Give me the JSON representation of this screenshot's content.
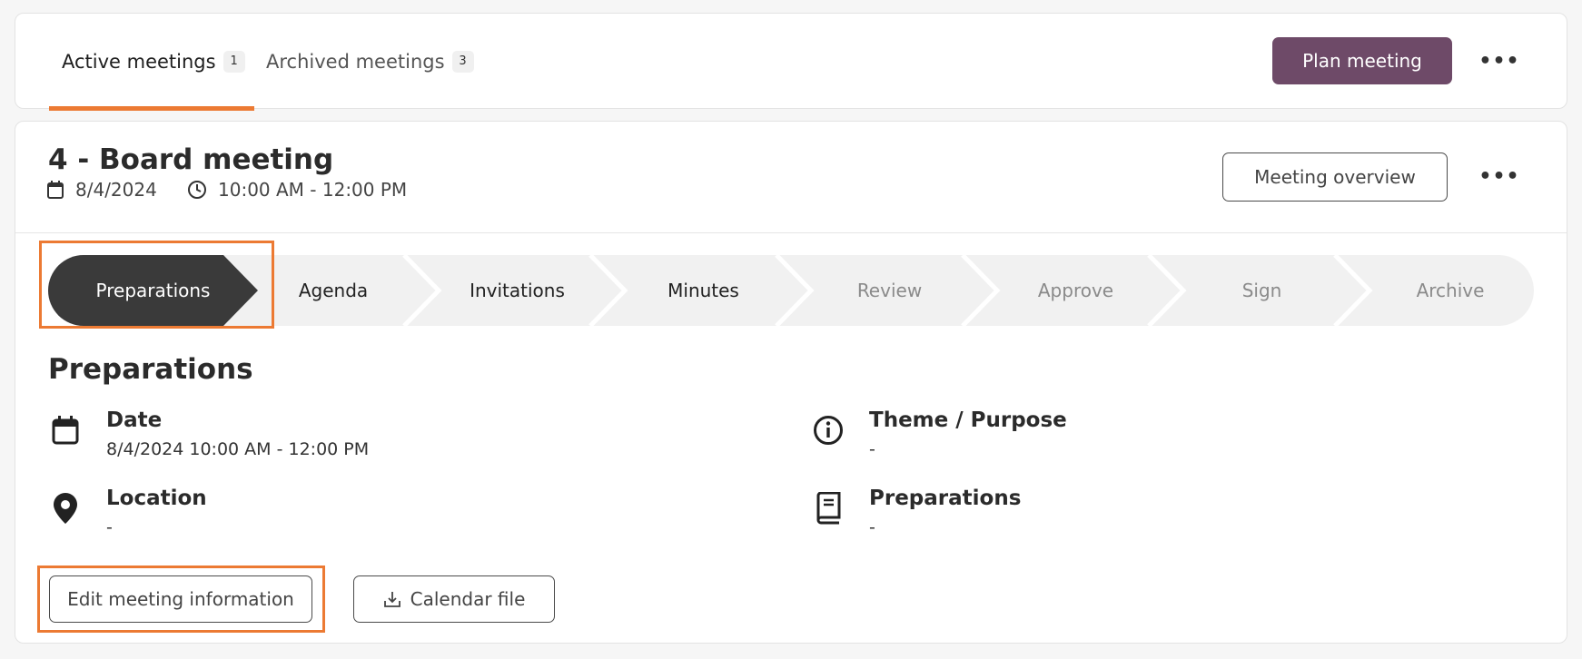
{
  "tabs": [
    {
      "label": "Active meetings",
      "count": "1"
    },
    {
      "label": "Archived meetings",
      "count": "3"
    }
  ],
  "header": {
    "plan_button": "Plan meeting",
    "more_label": "•••"
  },
  "meeting": {
    "title": "4 - Board meeting",
    "date": "8/4/2024",
    "time": "10:00 AM - 12:00 PM",
    "overview_button": "Meeting overview",
    "more_label": "•••"
  },
  "stepper": {
    "steps": [
      {
        "label": "Preparations",
        "state": "active"
      },
      {
        "label": "Agenda",
        "state": "done"
      },
      {
        "label": "Invitations",
        "state": "done"
      },
      {
        "label": "Minutes",
        "state": "done"
      },
      {
        "label": "Review",
        "state": "todo"
      },
      {
        "label": "Approve",
        "state": "todo"
      },
      {
        "label": "Sign",
        "state": "todo"
      },
      {
        "label": "Archive",
        "state": "todo"
      }
    ]
  },
  "section": {
    "title": "Preparations",
    "details": {
      "date": {
        "label": "Date",
        "value": "8/4/2024 10:00 AM - 12:00 PM",
        "icon": "calendar-icon"
      },
      "location": {
        "label": "Location",
        "value": "-",
        "icon": "location-pin-icon"
      },
      "theme": {
        "label": "Theme / Purpose",
        "value": "-",
        "icon": "info-icon"
      },
      "preparations": {
        "label": "Preparations",
        "value": "-",
        "icon": "book-icon"
      }
    },
    "edit_button": "Edit meeting information",
    "calendar_button": "Calendar file"
  },
  "colors": {
    "accent_orange": "#ec7a33",
    "primary_purple": "#6e4a68",
    "active_step": "#3a3a3a",
    "stepper_bg": "#f1f1f1"
  }
}
